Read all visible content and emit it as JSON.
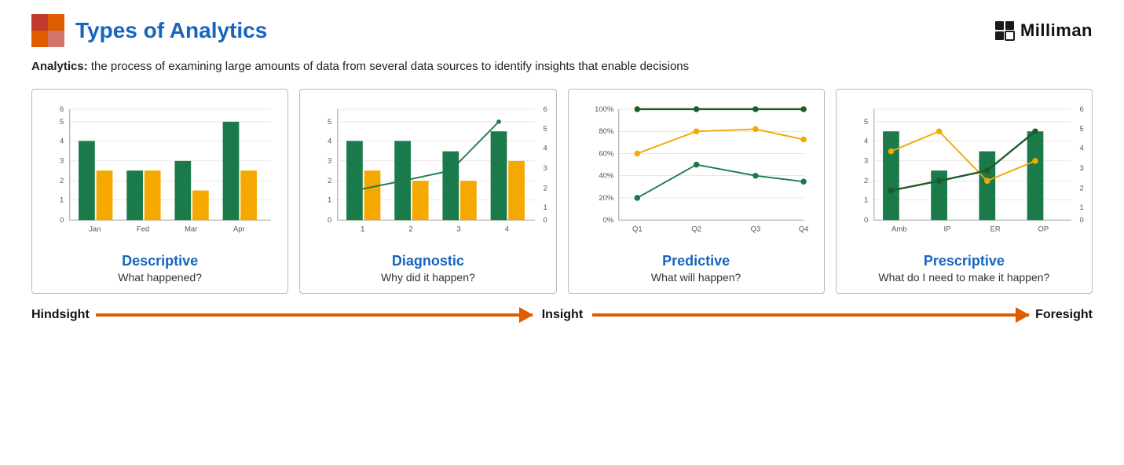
{
  "header": {
    "title": "Types of Analytics",
    "logo_text": "Milliman"
  },
  "subtitle": {
    "bold": "Analytics:",
    "text": " the process of examining large amounts of data from several data sources to identify insights that enable decisions"
  },
  "cards": [
    {
      "id": "descriptive",
      "title": "Descriptive",
      "subtitle": "What happened?",
      "chart_type": "bar",
      "x_labels": [
        "Jan",
        "Fed",
        "Mar",
        "Apr"
      ],
      "y_max": 6,
      "green_bars": [
        4,
        2,
        3,
        4.5
      ],
      "orange_bars": [
        2.5,
        2.5,
        1.5,
        3
      ]
    },
    {
      "id": "diagnostic",
      "title": "Diagnostic",
      "subtitle": "Why did it happen?",
      "chart_type": "bar_line",
      "x_labels": [
        "1",
        "2",
        "3",
        "4"
      ],
      "y_max": 6,
      "green_bars": [
        4,
        4,
        3.5,
        4.5
      ],
      "orange_bars": [
        2.5,
        2,
        2,
        3
      ],
      "line_points": [
        1.5,
        2,
        2.5,
        5
      ]
    },
    {
      "id": "predictive",
      "title": "Predictive",
      "subtitle": "What will happen?",
      "chart_type": "line",
      "x_labels": [
        "Q1",
        "Q2",
        "Q3",
        "Q4"
      ],
      "y_labels": [
        "0%",
        "20%",
        "40%",
        "60%",
        "80%",
        "100%"
      ],
      "green_line": [
        20,
        50,
        40,
        35
      ],
      "orange_line": [
        60,
        80,
        82,
        73
      ],
      "dark_green_line": [
        100,
        100,
        100,
        100
      ]
    },
    {
      "id": "prescriptive",
      "title": "Prescriptive",
      "subtitle": "What do I need to make it happen?",
      "chart_type": "bar_line",
      "x_labels": [
        "Amb",
        "IP",
        "ER",
        "OP"
      ],
      "y_max": 6,
      "green_bars": [
        4.5,
        2.5,
        3.5,
        4.5
      ],
      "orange_line": [
        3.5,
        4.5,
        2,
        3
      ],
      "line2": [
        1.5,
        2,
        2.5,
        4.5
      ]
    }
  ],
  "arrow": {
    "left_label": "Hindsight",
    "mid_label": "Insight",
    "right_label": "Foresight"
  }
}
